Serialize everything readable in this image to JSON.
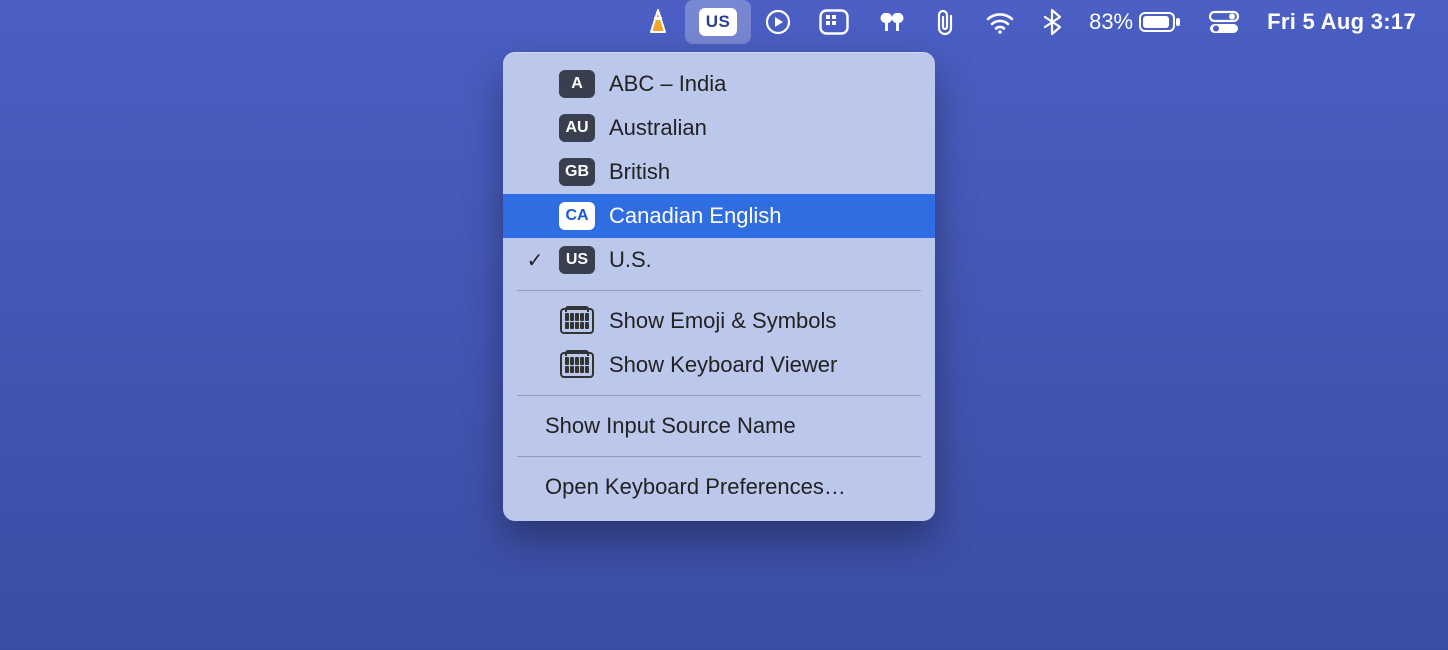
{
  "menubar": {
    "input_code": "US",
    "battery_percent": "83%",
    "clock": "Fri 5 Aug  3:17"
  },
  "dropdown": {
    "sources": [
      {
        "code": "A",
        "label": "ABC – India",
        "checked": false,
        "highlight": false,
        "badgeStyle": "dark"
      },
      {
        "code": "AU",
        "label": "Australian",
        "checked": false,
        "highlight": false,
        "badgeStyle": "dark"
      },
      {
        "code": "GB",
        "label": "British",
        "checked": false,
        "highlight": false,
        "badgeStyle": "dark"
      },
      {
        "code": "CA",
        "label": "Canadian English",
        "checked": false,
        "highlight": true,
        "badgeStyle": "white"
      },
      {
        "code": "US",
        "label": "U.S.",
        "checked": true,
        "highlight": false,
        "badgeStyle": "dark"
      }
    ],
    "show_emoji": "Show Emoji & Symbols",
    "show_viewer": "Show Keyboard Viewer",
    "show_name": "Show Input Source Name",
    "open_prefs": "Open Keyboard Preferences…"
  }
}
